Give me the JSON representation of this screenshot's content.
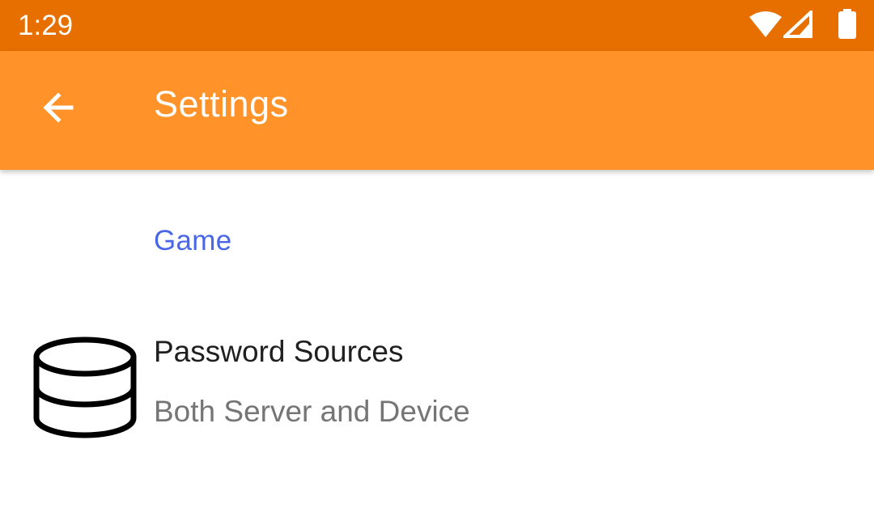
{
  "status_bar": {
    "time": "1:29",
    "icons": [
      "wifi-icon",
      "cell-signal-icon",
      "battery-icon"
    ]
  },
  "app_bar": {
    "back_icon": "arrow-back-icon",
    "title": "Settings"
  },
  "content": {
    "category": "Game",
    "preferences": [
      {
        "icon": "database-icon",
        "title": "Password Sources",
        "summary": "Both Server and Device"
      }
    ]
  },
  "colors": {
    "status_bar": "#E76F00",
    "app_bar": "#FF9228",
    "category_accent": "#4A66E8",
    "title_text": "#202020",
    "summary_text": "#757575"
  }
}
